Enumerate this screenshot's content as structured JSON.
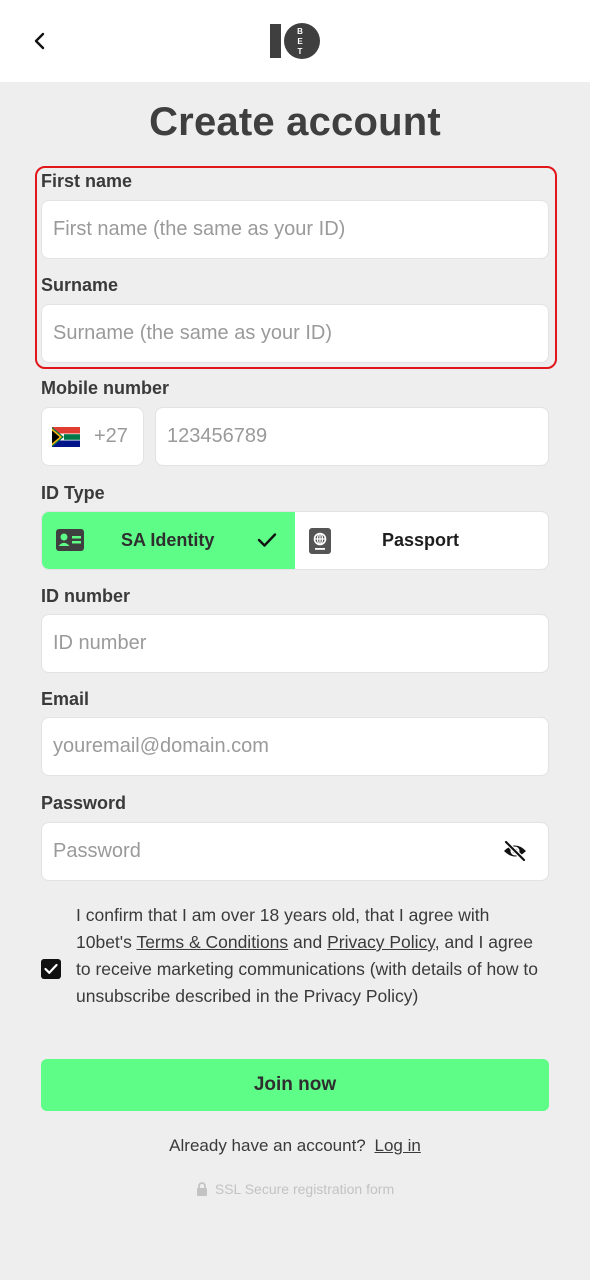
{
  "header": {
    "logo_text": "10BET"
  },
  "page": {
    "title": "Create account"
  },
  "form": {
    "first_name": {
      "label": "First name",
      "placeholder": "First name (the same as your ID)",
      "value": ""
    },
    "surname": {
      "label": "Surname",
      "placeholder": "Surname (the same as your ID)",
      "value": ""
    },
    "mobile": {
      "label": "Mobile number",
      "country_code": "+27",
      "placeholder": "123456789",
      "value": ""
    },
    "id_type": {
      "label": "ID Type",
      "options": [
        {
          "label": "SA Identity",
          "selected": true
        },
        {
          "label": "Passport",
          "selected": false
        }
      ]
    },
    "id_number": {
      "label": "ID number",
      "placeholder": "ID number",
      "value": ""
    },
    "email": {
      "label": "Email",
      "placeholder": "youremail@domain.com",
      "value": ""
    },
    "password": {
      "label": "Password",
      "placeholder": "Password",
      "value": ""
    }
  },
  "consent": {
    "checked": true,
    "text_1": "I confirm that I am over 18 years old, that I agree with 10bet's ",
    "terms_link": "Terms & Conditions",
    "text_2": " and ",
    "privacy_link": "Privacy Policy",
    "text_3": ", and I agree to receive marketing communications (with details of how to unsubscribe described in the Privacy Policy)"
  },
  "actions": {
    "join_label": "Join now"
  },
  "footer": {
    "have_account": "Already have an account?",
    "login_link": "Log in",
    "ssl_text": "SSL Secure registration form"
  },
  "colors": {
    "accent": "#5dfd87",
    "highlight_border": "#e0161b",
    "background": "#eeeeee"
  }
}
